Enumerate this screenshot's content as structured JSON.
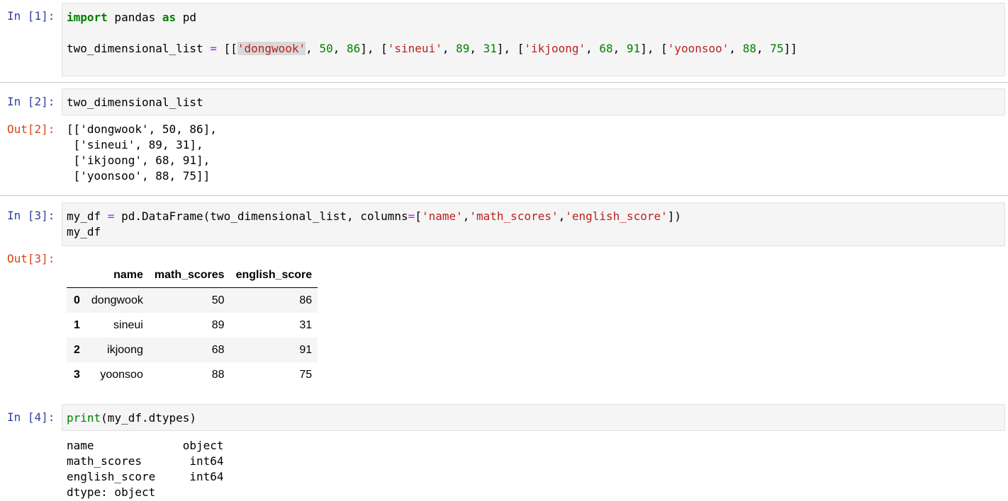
{
  "cells": [
    {
      "prompt": "In [1]:",
      "tokens": {
        "import": "import",
        "pandas": " pandas ",
        "as": "as",
        "pd": " pd",
        "var": "two_dimensional_list ",
        "eq": "=",
        "open": " [[",
        "s1": "'dongwook'",
        "c1": ", ",
        "n1a": "50",
        "c2": ", ",
        "n1b": "86",
        "c3": "], [",
        "s2": "'sineui'",
        "c4": ", ",
        "n2a": "89",
        "c5": ", ",
        "n2b": "31",
        "c6": "], [",
        "s3": "'ikjoong'",
        "c7": ", ",
        "n3a": "68",
        "c8": ", ",
        "n3b": "91",
        "c9": "], [",
        "s4": "'yoonsoo'",
        "c10": ", ",
        "n4a": "88",
        "c11": ", ",
        "n4b": "75",
        "close": "]]"
      }
    },
    {
      "prompt": "In [2]:",
      "code": "two_dimensional_list",
      "out_prompt": "Out[2]:",
      "output": [
        "[['dongwook', 50, 86],",
        " ['sineui', 89, 31],",
        " ['ikjoong', 68, 91],",
        " ['yoonsoo', 88, 75]]"
      ]
    },
    {
      "prompt": "In [3]:",
      "tokens": {
        "a": "my_df ",
        "eq": "=",
        "b": " pd.DataFrame(two_dimensional_list, columns",
        "eq2": "=",
        "c": "[",
        "s1": "'name'",
        "d": ",",
        "s2": "'math_scores'",
        "e": ",",
        "s3": "'english_score'",
        "f": "])"
      },
      "line2": "my_df",
      "out_prompt": "Out[3]:",
      "dataframe": {
        "columns": [
          "",
          "name",
          "math_scores",
          "english_score"
        ],
        "rows": [
          [
            "0",
            "dongwook",
            "50",
            "86"
          ],
          [
            "1",
            "sineui",
            "89",
            "31"
          ],
          [
            "2",
            "ikjoong",
            "68",
            "91"
          ],
          [
            "3",
            "yoonsoo",
            "88",
            "75"
          ]
        ]
      }
    },
    {
      "prompt": "In [4]:",
      "tokens": {
        "fn": "print",
        "rest": "(my_df.dtypes)"
      },
      "output": [
        "name             object",
        "math_scores       int64",
        "english_score     int64",
        "dtype: object"
      ]
    }
  ]
}
